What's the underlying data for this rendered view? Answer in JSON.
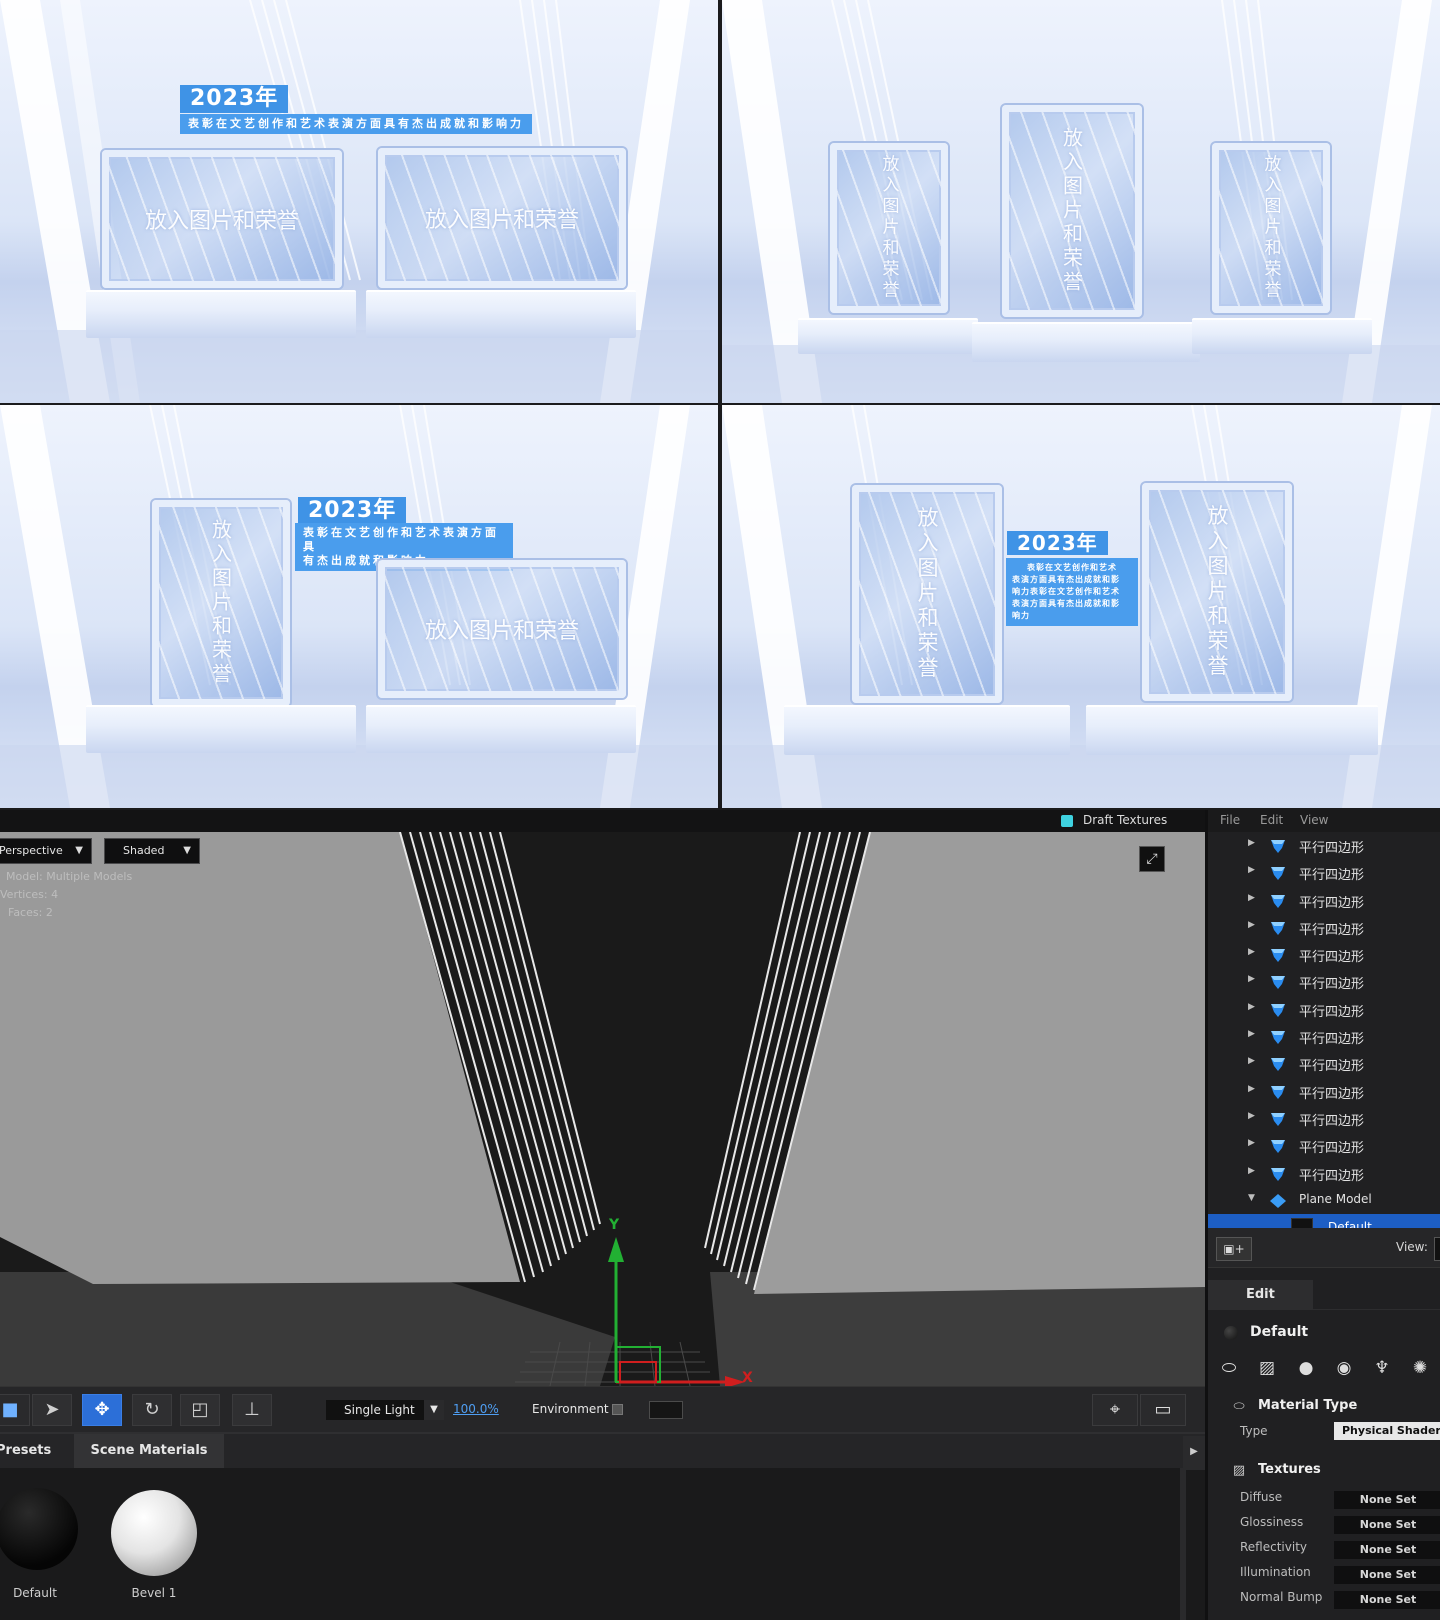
{
  "previews": {
    "p1": {
      "year": "2023年",
      "desc": "表彰在文艺创作和艺术表演方面具有杰出成就和影响力",
      "frame_a": "放入图片和荣誉",
      "frame_b": "放入图片和荣誉"
    },
    "p2": {
      "frame_a": "放入图片和荣誉",
      "frame_b": "放入图片和荣誉",
      "frame_c": "放入图片和荣誉"
    },
    "p3": {
      "year": "2023年",
      "desc_line1": "表彰在文艺创作和艺术表演方面具",
      "desc_line2": "有杰出成就和影响力",
      "frame_a": "放入图片和荣誉",
      "frame_b": "放入图片和荣誉"
    },
    "p4": {
      "year": "2023年",
      "desc_lines": [
        "表彰在文艺创作和艺术",
        "表演方面具有杰出成就和影",
        "响力表彰在文艺创作和艺术",
        "表演方面具有杰出成就和影",
        "响力"
      ],
      "frame_a": "放入图片和荣誉",
      "frame_b": "放入图片和荣誉"
    }
  },
  "viewport": {
    "draft_textures_label": "Draft Textures",
    "projection": "Perspective",
    "shading": "Shaded",
    "model_label": "Model:",
    "model_value": "Multiple Models",
    "vertices_label": "Vertices:",
    "vertices_value": "4",
    "faces_label": "Faces:",
    "faces_value": "2",
    "axis_y": "Y",
    "axis_x": "X"
  },
  "toolbar": {
    "light_mode": "Single Light",
    "light_intensity": "100.0%",
    "environment_label": "Environment"
  },
  "materials": {
    "tabs": [
      "Presets",
      "Scene Materials"
    ],
    "items": [
      {
        "label": "Default"
      },
      {
        "label": "Bevel 1"
      }
    ]
  },
  "scene_panel": {
    "menu": [
      "File",
      "Edit",
      "View"
    ],
    "items": [
      "平行四边形",
      "平行四边形",
      "平行四边形",
      "平行四边形",
      "平行四边形",
      "平行四边形",
      "平行四边形",
      "平行四边形",
      "平行四边形",
      "平行四边形",
      "平行四边形",
      "平行四边形",
      "平行四边形"
    ],
    "plane_model": "Plane Model",
    "default_material": "Default",
    "view_label": "View:"
  },
  "properties": {
    "tab": "Edit",
    "material_name": "Default",
    "material_type_header": "Material Type",
    "type_label": "Type",
    "type_value": "Physical Shader",
    "textures_header": "Textures",
    "textures": [
      {
        "label": "Diffuse",
        "value": "None Set"
      },
      {
        "label": "Glossiness",
        "value": "None Set"
      },
      {
        "label": "Reflectivity",
        "value": "None Set"
      },
      {
        "label": "Illumination",
        "value": "None Set"
      },
      {
        "label": "Normal Bump",
        "value": "None Set"
      }
    ]
  },
  "colors": {
    "accent": "#1d5ec4",
    "tag_blue": "#3f93e6",
    "axis_y": "#2ecc40",
    "axis_x": "#e02020"
  }
}
